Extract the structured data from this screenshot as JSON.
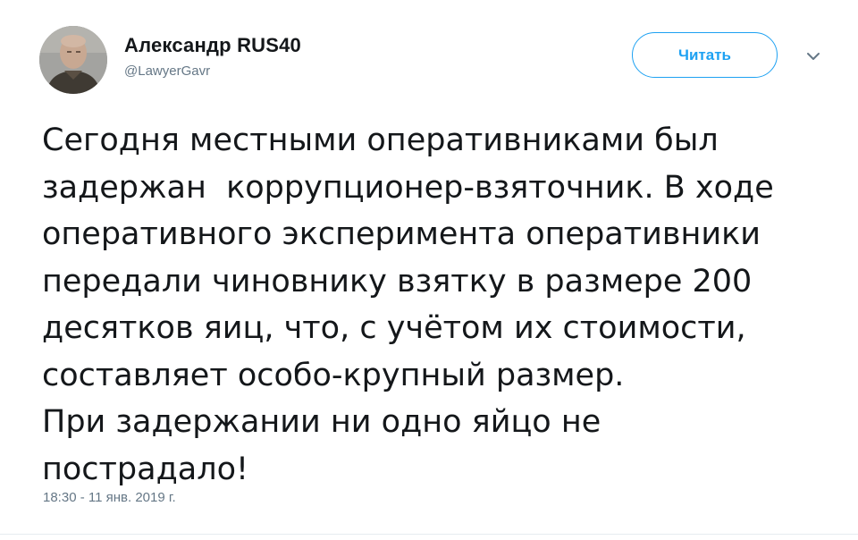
{
  "user": {
    "display_name": "Александр RUS40",
    "handle": "@LawyerGavr"
  },
  "follow_button": {
    "label": "Читать"
  },
  "menu": {
    "icon": "chevron-down-icon"
  },
  "tweet": {
    "text": "Сегодня местными оперативниками был\nзадержан  коррупционер-взяточник. В ходе\nоперативного эксперимента оперативники\nпередали чиновнику взятку в размере 200\nдесятков яиц, что, с учётом их стоимости,\nсоставляет особо-крупный размер.\nПри задержании ни одно яйцо не\nпострадало!",
    "timestamp": "18:30 - 11 янв. 2019 г."
  },
  "colors": {
    "accent": "#1da1f2",
    "text": "#14171a",
    "secondary": "#657786"
  }
}
